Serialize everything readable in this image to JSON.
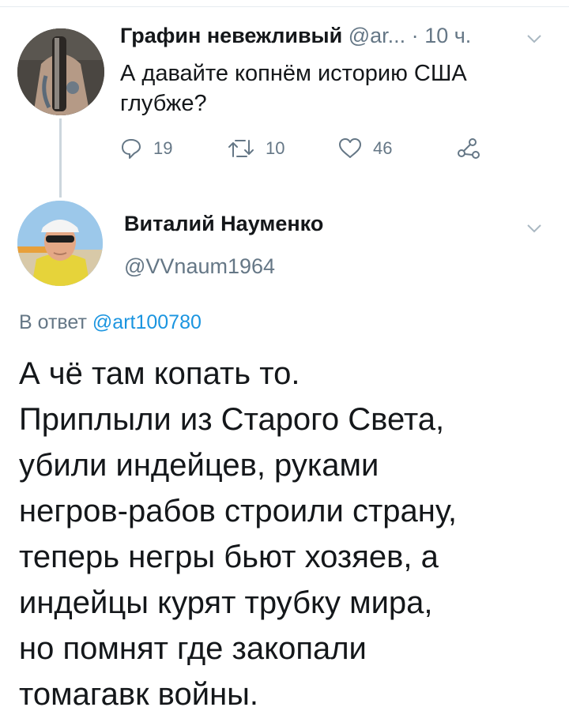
{
  "tweet1": {
    "author_name": "Графин невежливый",
    "author_handle": "@ar...",
    "separator": "·",
    "time": "10 ч.",
    "text_lines": [
      "А давайте копнём историю США",
      "глубже?"
    ],
    "actions": {
      "replies": "19",
      "retweets": "10",
      "likes": "46"
    }
  },
  "tweet2": {
    "author_name": "Виталий Науменко",
    "author_handle": "@VVnaum1964",
    "reply_prefix": "В ответ",
    "reply_mention": "@art100780",
    "text_lines": [
      "А чё там копать то.",
      "Приплыли из Старого Света,",
      "убили индейцев, руками",
      "негров-рабов строили страну,",
      "теперь негры бьют хозяев, а",
      "индейцы курят трубку мира,",
      "но помнят где закопали",
      "томагавк войны."
    ]
  },
  "colors": {
    "text_primary": "#14171a",
    "text_secondary": "#657786",
    "link": "#1b95e0",
    "divider": "#e6ecf0"
  },
  "icons": [
    "chevron-down-icon",
    "reply-icon",
    "retweet-icon",
    "like-icon",
    "share-icon"
  ]
}
